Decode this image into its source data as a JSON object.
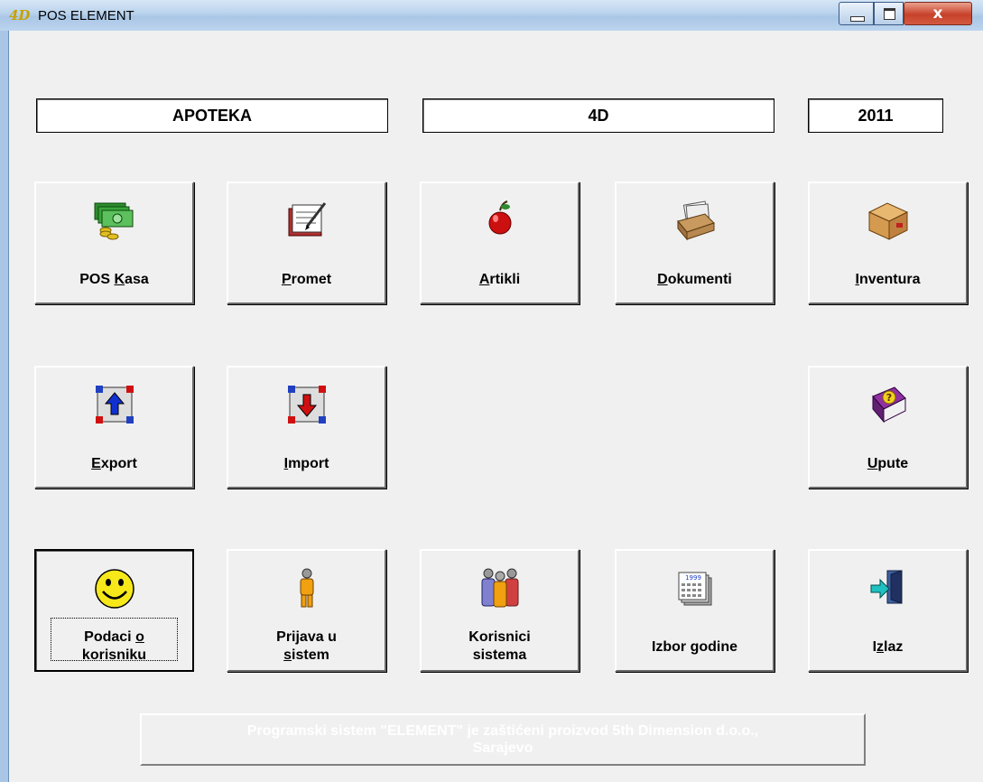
{
  "window": {
    "title": "POS ELEMENT",
    "close_symbol": "x",
    "controls": [
      "minimize",
      "maximize",
      "close"
    ]
  },
  "header_fields": {
    "firm": "APOTEKA",
    "company": "4D",
    "year": "2011"
  },
  "buttons": {
    "pos_kasa": {
      "pre": "POS ",
      "mnemonic": "K",
      "post": "asa",
      "icon": "cash-register-icon"
    },
    "promet": {
      "pre": "",
      "mnemonic": "P",
      "post": "romet",
      "icon": "notebook-pen-icon"
    },
    "artikli": {
      "pre": "",
      "mnemonic": "A",
      "post": "rtikli",
      "icon": "apple-icon"
    },
    "dokumenti": {
      "pre": "",
      "mnemonic": "D",
      "post": "okumenti",
      "icon": "file-box-icon"
    },
    "inventura": {
      "pre": "",
      "mnemonic": "I",
      "post": "nventura",
      "icon": "package-icon"
    },
    "export": {
      "pre": "",
      "mnemonic": "E",
      "post": "xport",
      "icon": "export-icon"
    },
    "import": {
      "pre": "",
      "mnemonic": "I",
      "post": "mport",
      "icon": "import-icon"
    },
    "upute": {
      "pre": "",
      "mnemonic": "U",
      "post": "pute",
      "icon": "help-book-icon"
    },
    "podaci": {
      "line1_pre": "Podaci ",
      "line1_mnemonic": "o",
      "line2": "korisniku",
      "icon": "smiley-icon"
    },
    "prijava": {
      "line1": "Prijava u",
      "line2_mnemonic": "s",
      "line2_post": "istem",
      "icon": "user-icon"
    },
    "korisnici": {
      "line1": "Korisnici",
      "line2": "sistema",
      "icon": "users-icon"
    },
    "izbor": {
      "label": "Izbor godine",
      "icon": "calendar-icon",
      "calendar_year": "1999"
    },
    "izlaz": {
      "pre": "I",
      "mnemonic": "z",
      "post": "laz",
      "icon": "exit-door-icon"
    }
  },
  "footer": {
    "line1": "Programski sistem \"ELEMENT\" je zaštićeni proizvod 5th Dimension d.o.o.,",
    "line2": "Sarajevo"
  }
}
